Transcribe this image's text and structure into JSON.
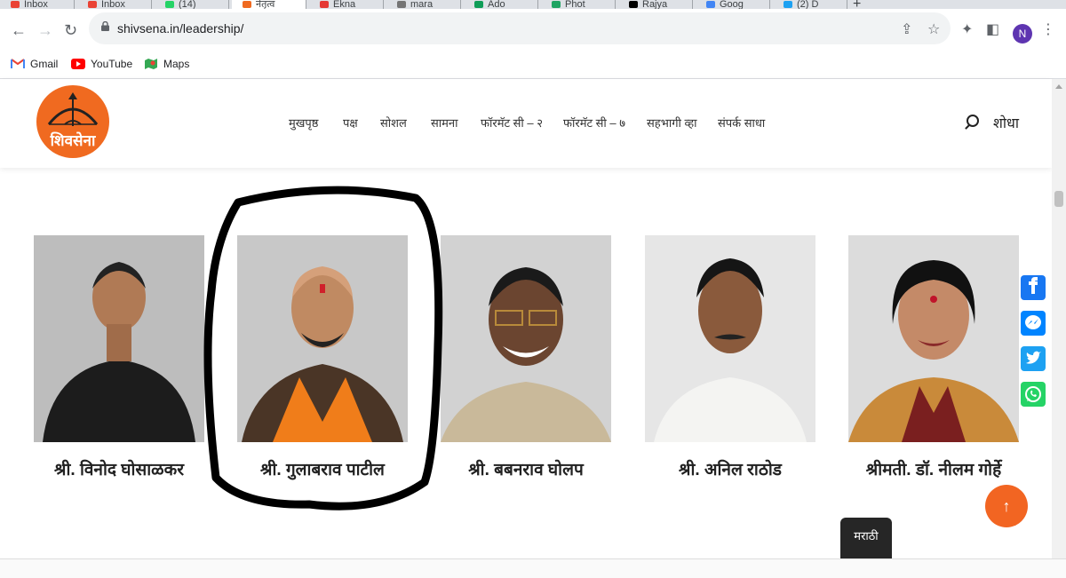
{
  "browser": {
    "tabs": [
      {
        "label": "Inbox",
        "color": "#ea4335"
      },
      {
        "label": "Inbox",
        "color": "#ea4335"
      },
      {
        "label": "(14)",
        "color": "#25d366"
      },
      {
        "label": "नेतृत्व",
        "color": "#f06a20",
        "active": true
      },
      {
        "label": "Ekna",
        "color": "#e53935"
      },
      {
        "label": "mara",
        "color": "#757575"
      },
      {
        "label": "Ado",
        "color": "#0f9d58"
      },
      {
        "label": "Phot",
        "color": "#1fa463"
      },
      {
        "label": "Rajya",
        "color": "#000000"
      },
      {
        "label": "Goog",
        "color": "#4285f4"
      },
      {
        "label": "(2) D",
        "color": "#1da1f2"
      }
    ],
    "new_tab_label": "+",
    "url": "shivsena.in/leadership/",
    "profile_initial": "N",
    "bookmarks": [
      {
        "label": "Gmail",
        "icon": "gmail-icon",
        "color": "#ea4335"
      },
      {
        "label": "YouTube",
        "icon": "youtube-icon",
        "color": "#ff0000"
      },
      {
        "label": "Maps",
        "icon": "maps-icon",
        "color": "#34a853"
      }
    ]
  },
  "site": {
    "logo_text": "शिवसेना",
    "nav": [
      "मुखपृष्ठ",
      "पक्ष",
      "सोशल",
      "सामना",
      "फॉरमॅट सी – २",
      "फॉरमॅट सी – ७",
      "सहभागी व्हा",
      "संपर्क साधा"
    ],
    "search_label": "शोधा",
    "leaders": [
      {
        "name": "श्री. विनोद घोसाळकर",
        "photo": "portrait-man-black-bandhgala"
      },
      {
        "name": "श्री. गुलाबराव पाटील",
        "photo": "portrait-man-saffron-scarf",
        "highlighted": true
      },
      {
        "name": "श्री. बबनराव घोलप",
        "photo": "portrait-man-glasses-smiling"
      },
      {
        "name": "श्री. अनिल राठोड",
        "photo": "portrait-man-white-shirt"
      },
      {
        "name": "श्रीमती. डॉ. नीलम गोर्हे",
        "photo": "portrait-woman-saree"
      }
    ],
    "share_buttons": [
      {
        "name": "facebook",
        "color": "#1877f2"
      },
      {
        "name": "messenger",
        "color": "#0084ff"
      },
      {
        "name": "twitter",
        "color": "#1da1f2"
      },
      {
        "name": "whatsapp",
        "color": "#25d366"
      }
    ],
    "language_button": "मराठी",
    "scroll_top_label": "↑"
  }
}
